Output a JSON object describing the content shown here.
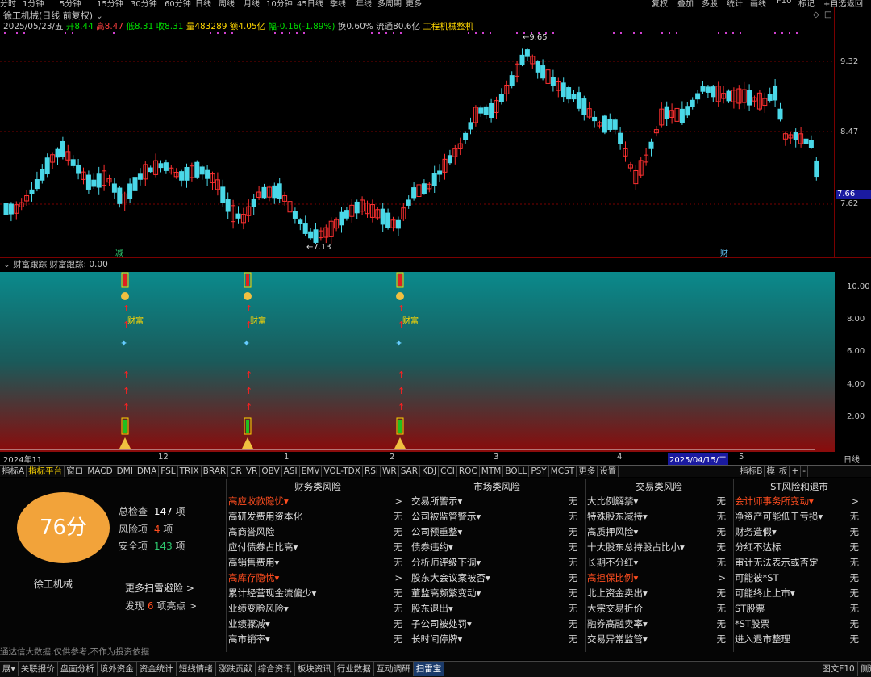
{
  "periods": [
    "分时",
    "1分钟",
    "5分钟",
    "15分钟",
    "30分钟",
    "60分钟",
    "日线",
    "周线",
    "月线",
    "10分钟",
    "45日线",
    "季线",
    "年线",
    "多周期",
    "更多"
  ],
  "top_right": [
    "复权",
    "叠加",
    "多股",
    "统计",
    "画线",
    "F10",
    "标记",
    "+自选",
    "返回"
  ],
  "stock": {
    "title": "徐工机械(日线 前复权)",
    "date": "2025/05/23/五",
    "open": "开8.44",
    "high": "高8.47",
    "low": "低8.31",
    "close": "收8.31",
    "volume": "量483289",
    "amount": "额4.05亿",
    "change": "幅-0.16(-1.89%)",
    "turnover": "换0.60%",
    "float": "流通80.6亿",
    "industry": "工程机械整机"
  },
  "price_axis": [
    "9.32",
    "8.47",
    "7.66",
    "7.62"
  ],
  "annotations": {
    "high": "9.65",
    "low": "7.13",
    "tag_a": "减",
    "tag_b": "财"
  },
  "indicator": {
    "title": "财富跟踪 财富跟踪: 0.00",
    "axis": [
      "10.00",
      "8.00",
      "6.00",
      "4.00",
      "2.00"
    ],
    "label": "财富"
  },
  "dates": {
    "d1": "2024年11",
    "d2": "12",
    "d3": "1",
    "d4": "2",
    "d5": "3",
    "d6": "4",
    "d7": "2025/04/15/二",
    "d8": "5",
    "right": "日线"
  },
  "tabs": [
    "指标A",
    "指标平台",
    "窗口",
    "MACD",
    "DMI",
    "DMA",
    "FSL",
    "TRIX",
    "BRAR",
    "CR",
    "VR",
    "OBV",
    "ASI",
    "EMV",
    "VOL-TDX",
    "RSI",
    "WR",
    "SAR",
    "KDJ",
    "CCI",
    "ROC",
    "MTM",
    "BOLL",
    "PSY",
    "MCST",
    "更多",
    "设置"
  ],
  "tabs_right": [
    "指标B",
    "模",
    "板",
    "+",
    "-"
  ],
  "summary": {
    "score": "76分",
    "name": "徐工机械",
    "check_label": "总检查",
    "check_value": "147",
    "check_unit": "项",
    "risk_label": "风险项",
    "risk_value": "4",
    "risk_unit": "项",
    "safe_label": "安全项",
    "safe_value": "143",
    "safe_unit": "项",
    "more": "更多扫雷避险 >",
    "found_pre": "发现",
    "found_value": "6",
    "found_post": "项亮点 >",
    "disclaimer": "通达信大数据,仅供参考,不作为投资依据"
  },
  "columns": [
    {
      "title": "财务类风险",
      "rows": [
        [
          "高应收款隐忧▾",
          ">"
        ],
        [
          "高研发费用资本化",
          "无"
        ],
        [
          "高商誉风险",
          "无"
        ],
        [
          "应付债券占比高▾",
          "无"
        ],
        [
          "高销售费用▾",
          "无"
        ],
        [
          "高库存隐忧▾",
          ">"
        ],
        [
          "累计经营现金流偏少▾",
          "无"
        ],
        [
          "业绩变脸风险▾",
          "无"
        ],
        [
          "业绩骤减▾",
          "无"
        ],
        [
          "高市销率▾",
          "无"
        ]
      ]
    },
    {
      "title": "市场类风险",
      "rows": [
        [
          "交易所警示▾",
          "无"
        ],
        [
          "公司被监管警示▾",
          "无"
        ],
        [
          "公司预重整▾",
          "无"
        ],
        [
          "债券违约▾",
          "无"
        ],
        [
          "分析师评级下调▾",
          "无"
        ],
        [
          "股东大会议案被否▾",
          "无"
        ],
        [
          "董监高频繁变动▾",
          "无"
        ],
        [
          "股东退出▾",
          "无"
        ],
        [
          "子公司被处罚▾",
          "无"
        ],
        [
          "长时间停牌▾",
          "无"
        ]
      ]
    },
    {
      "title": "交易类风险",
      "rows": [
        [
          "大比例解禁▾",
          "无"
        ],
        [
          "特殊股东减持▾",
          "无"
        ],
        [
          "高质押风险▾",
          "无"
        ],
        [
          "十大股东总持股占比小▾",
          "无"
        ],
        [
          "长期不分红▾",
          "无"
        ],
        [
          "高担保比例▾",
          ">"
        ],
        [
          "北上资金卖出▾",
          "无"
        ],
        [
          "大宗交易折价",
          "无"
        ],
        [
          "融券高融卖率▾",
          "无"
        ],
        [
          "交易异常监管▾",
          "无"
        ]
      ]
    },
    {
      "title": "ST风险和退市",
      "rows": [
        [
          "会计师事务所变动▾",
          ">"
        ],
        [
          "净资产可能低于亏损▾",
          "无"
        ],
        [
          "财务造假▾",
          "无"
        ],
        [
          "分红不达标",
          "无"
        ],
        [
          "审计无法表示或否定",
          "无"
        ],
        [
          "可能被*ST",
          "无"
        ],
        [
          "可能终止上市▾",
          "无"
        ],
        [
          "ST股票",
          "无"
        ],
        [
          "*ST股票",
          "无"
        ],
        [
          "进入退市整理",
          "无"
        ]
      ]
    }
  ],
  "red_rows": [
    [
      0,
      0
    ],
    [
      0,
      5
    ],
    [
      2,
      5
    ],
    [
      3,
      0
    ]
  ],
  "bottom_tabs": [
    "展▾",
    "关联报价",
    "盘面分析",
    "境外资金",
    "资金统计",
    "短线情绪",
    "涨跌贡献",
    "综合资讯",
    "板块资讯",
    "行业数据",
    "互动调研",
    "扫雷宝"
  ],
  "bottom_right": [
    "图文F10",
    "侧边栏>"
  ]
}
